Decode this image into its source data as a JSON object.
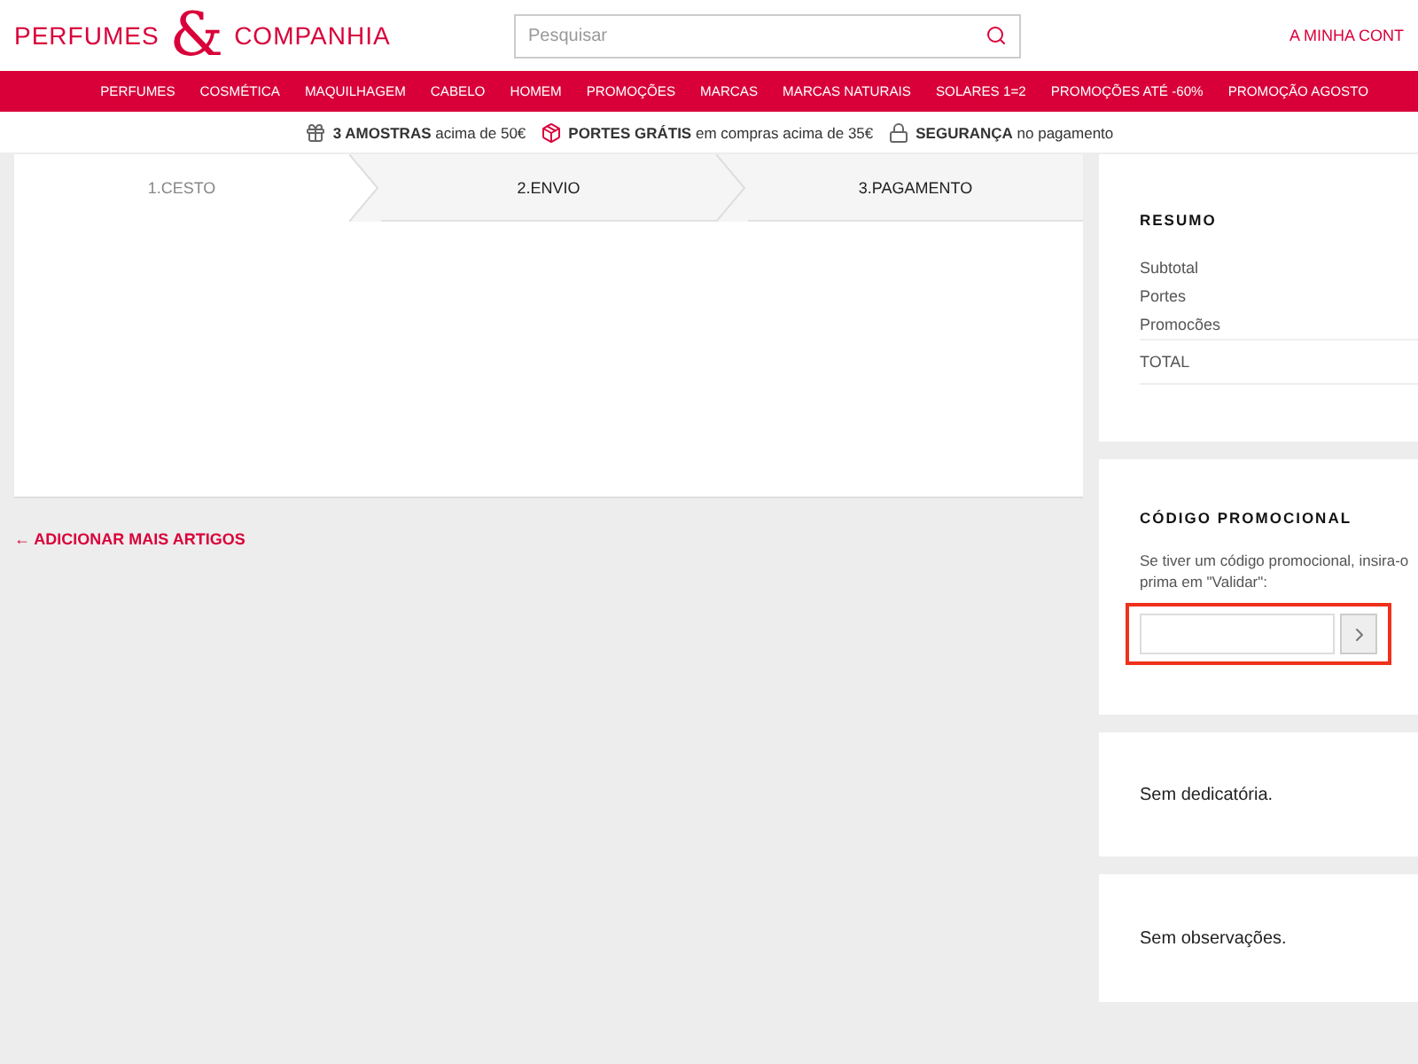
{
  "header": {
    "logo": {
      "left": "PERFUMES",
      "mark": "&",
      "right": "COMPANHIA"
    },
    "search": {
      "placeholder": "Pesquisar"
    },
    "account": "A MINHA CONT"
  },
  "nav": [
    "PERFUMES",
    "COSMÉTICA",
    "MAQUILHAGEM",
    "CABELO",
    "HOMEM",
    "PROMOÇÕES",
    "MARCAS",
    "MARCAS NATURAIS",
    "SOLARES 1=2",
    "PROMOÇÕES ATÉ -60%",
    "PROMOÇÃO AGOSTO"
  ],
  "perks": [
    {
      "kind": "gift",
      "text": "**3 AMOSTRAS** acima de 50€"
    },
    {
      "kind": "box",
      "text": "**PORTES GRÁTIS** em compras acima de 35€"
    },
    {
      "kind": "lock",
      "text": "**SEGURANÇA** no pagamento"
    }
  ],
  "steps": [
    {
      "label": "1.CESTO",
      "selected": true
    },
    {
      "label": "2.ENVIO",
      "selected": false
    },
    {
      "label": "3.PAGAMENTO",
      "selected": false
    }
  ],
  "back_link": "← ADICIONAR MAIS ARTIGOS",
  "summary": {
    "title": "RESUMO",
    "rows": [
      "Subtotal",
      "Portes",
      "Promocões"
    ],
    "total": "TOTAL"
  },
  "promo": {
    "title": "CÓDIGO PROMOCIONAL",
    "text": "Se tiver um código promocional, insira-o prima em \"Validar\":",
    "highlighted": true
  },
  "dedication": "Sem dedicatória.",
  "notes": "Sem observações."
}
